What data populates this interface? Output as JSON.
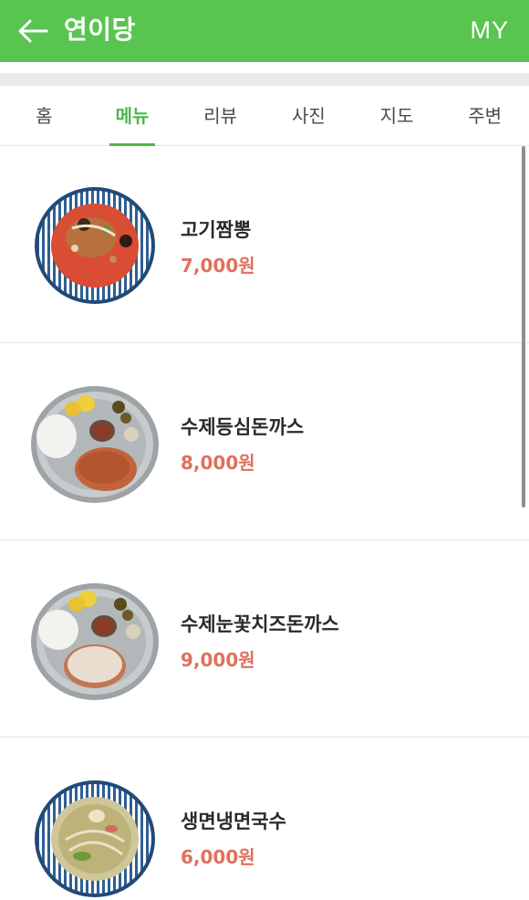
{
  "header": {
    "title": "연이당",
    "right_label": "MY",
    "back_icon": "arrow-left-icon",
    "bg_color": "#5ac450"
  },
  "tabs": [
    {
      "label": "홈",
      "active": false
    },
    {
      "label": "메뉴",
      "active": true
    },
    {
      "label": "리뷰",
      "active": false
    },
    {
      "label": "사진",
      "active": false
    },
    {
      "label": "지도",
      "active": false
    },
    {
      "label": "주변",
      "active": false
    }
  ],
  "menu": {
    "items": [
      {
        "name": "고기짬뽕",
        "price": "7,000원",
        "image": "jjamppong-bowl"
      },
      {
        "name": "수제등심돈까스",
        "price": "8,000원",
        "image": "tonkatsu-plate"
      },
      {
        "name": "수제눈꽃치즈돈까스",
        "price": "9,000원",
        "image": "cheese-tonkatsu-plate"
      },
      {
        "name": "생면냉면국수",
        "price": "6,000원",
        "image": "cold-noodle-bowl"
      }
    ]
  },
  "colors": {
    "accent": "#4cb84a",
    "price": "#e0705c"
  }
}
